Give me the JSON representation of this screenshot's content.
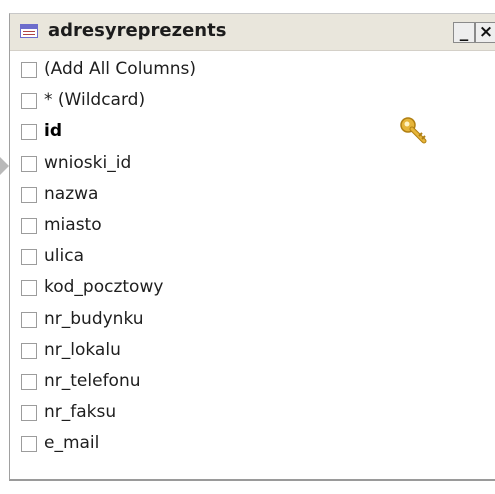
{
  "window": {
    "title": "adresyreprezents",
    "minimize_label": "_",
    "close_label": "×"
  },
  "columns": [
    {
      "label": "(Add All Columns)",
      "checked": false,
      "primary_key": false
    },
    {
      "label": "* (Wildcard)",
      "checked": false,
      "primary_key": false
    },
    {
      "label": "id",
      "checked": false,
      "primary_key": true,
      "icon": "key-icon"
    },
    {
      "label": "wnioski_id",
      "checked": false,
      "primary_key": false
    },
    {
      "label": "nazwa",
      "checked": false,
      "primary_key": false
    },
    {
      "label": "miasto",
      "checked": false,
      "primary_key": false
    },
    {
      "label": "ulica",
      "checked": false,
      "primary_key": false
    },
    {
      "label": "kod_pocztowy",
      "checked": false,
      "primary_key": false
    },
    {
      "label": "nr_budynku",
      "checked": false,
      "primary_key": false
    },
    {
      "label": "nr_lokalu",
      "checked": false,
      "primary_key": false
    },
    {
      "label": "nr_telefonu",
      "checked": false,
      "primary_key": false
    },
    {
      "label": "nr_faksu",
      "checked": false,
      "primary_key": false
    },
    {
      "label": "e_mail",
      "checked": false,
      "primary_key": false
    }
  ],
  "colors": {
    "titlebar_bg": "#e9e6dc",
    "key_gold": "#e6b53a"
  }
}
